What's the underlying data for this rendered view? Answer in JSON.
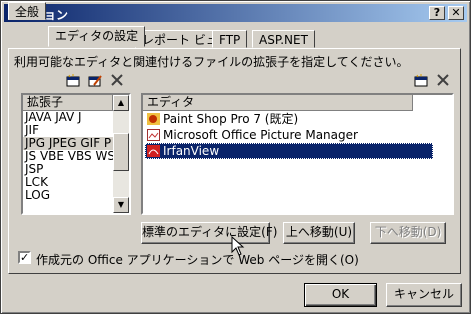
{
  "window": {
    "title": "オプション",
    "help_btn": "?",
    "close_btn": "✕"
  },
  "tabs": [
    {
      "label": "全般",
      "active": false
    },
    {
      "label": "エディタの設定",
      "active": true
    },
    {
      "label": "レポート ビュー",
      "active": false
    },
    {
      "label": "FTP",
      "active": false
    },
    {
      "label": "ASP.NET",
      "active": false
    }
  ],
  "description": "利用可能なエディタと関連付けるファイルの拡張子を指定してください。",
  "extensions": {
    "header": "拡張子",
    "items": [
      "JAVA JAV J",
      "JIF",
      "JPG JPEG GIF P",
      "JS VBE VBS WS",
      "JSP",
      "LCK",
      "LOG"
    ],
    "selected_index": 2
  },
  "editors": {
    "header": "エディタ",
    "items": [
      {
        "label": "Paint Shop Pro 7 (既定)",
        "icon": "paint-shop-pro-icon",
        "selected": false
      },
      {
        "label": "Microsoft Office Picture Manager",
        "icon": "picture-manager-icon",
        "selected": false
      },
      {
        "label": "IrfanView",
        "icon": "irfanview-icon",
        "selected": true
      }
    ]
  },
  "toolbar_icons": {
    "new": "new-icon",
    "edit": "edit-icon",
    "delete": "delete-icon"
  },
  "buttons": {
    "set_default": "標準のエディタに設定(F)",
    "move_up": "上へ移動(U)",
    "move_down": "下へ移動(D)",
    "ok": "OK",
    "cancel": "キャンセル"
  },
  "checkbox": {
    "label": "作成元の Office アプリケーションで Web ページを開く(O)",
    "checked": true
  },
  "colors": {
    "titlebar_start": "#0a246a",
    "titlebar_end": "#a6caf0",
    "face": "#d4d0c8",
    "selection": "#0a246a"
  }
}
